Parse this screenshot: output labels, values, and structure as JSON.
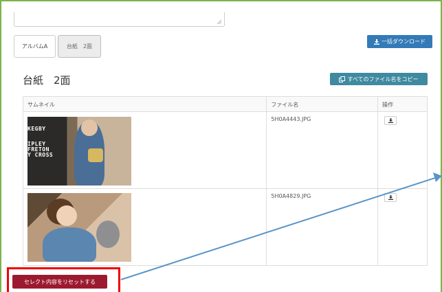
{
  "tabs": [
    {
      "label": "アルバムA"
    },
    {
      "label": "台紙　2面"
    }
  ],
  "download_all_label": "一括ダウンロード",
  "section_title": "台紙　2面",
  "copy_all_label": "すべてのファイル名をコピー",
  "table": {
    "headers": [
      "サムネイル",
      "ファイル名",
      "操作"
    ],
    "rows": [
      {
        "file_name": "5H0A4443.JPG",
        "photo_sign_text": [
          "KEGBY",
          "IPLEY",
          "FRETON",
          "Y CROSS"
        ]
      },
      {
        "file_name": "5H0A4829.JPG"
      }
    ]
  },
  "reset_label": "セレクト内容をリセットする",
  "colors": {
    "frame_border": "#79b548",
    "primary_button": "#337ab7",
    "copy_button": "#3f8aa0",
    "reset_button": "#9c1a2f",
    "highlight": "#ee0000",
    "arrow": "#5a95c8"
  }
}
